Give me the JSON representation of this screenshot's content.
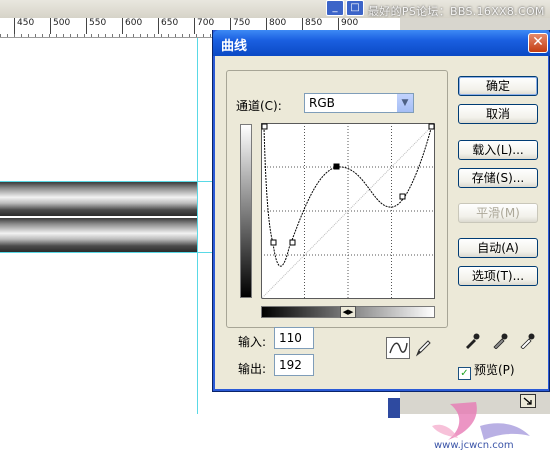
{
  "window": {
    "watermark": "最好的PS论坛：BBS.16XX8.COM"
  },
  "ruler": {
    "ticks": [
      "450",
      "500",
      "550",
      "600",
      "650",
      "700",
      "750",
      "800",
      "850",
      "900"
    ]
  },
  "dialog": {
    "title": "曲线",
    "channel_label": "通道(C):",
    "channel_value": "RGB",
    "input_label": "输入:",
    "input_value": "110",
    "output_label": "输出:",
    "output_value": "192",
    "buttons": {
      "ok": "确定",
      "cancel": "取消",
      "load": "载入(L)...",
      "save": "存储(S)...",
      "smooth": "平滑(M)",
      "auto": "自动(A)",
      "options": "选项(T)..."
    },
    "preview_label": "预览(P)",
    "preview_checked": true
  },
  "logo": {
    "text": "www.jcwcn.com"
  },
  "colors": {
    "title_blue": "#0b49c4",
    "dialog_bg": "#ece9d8",
    "guide": "#59d9e6"
  }
}
